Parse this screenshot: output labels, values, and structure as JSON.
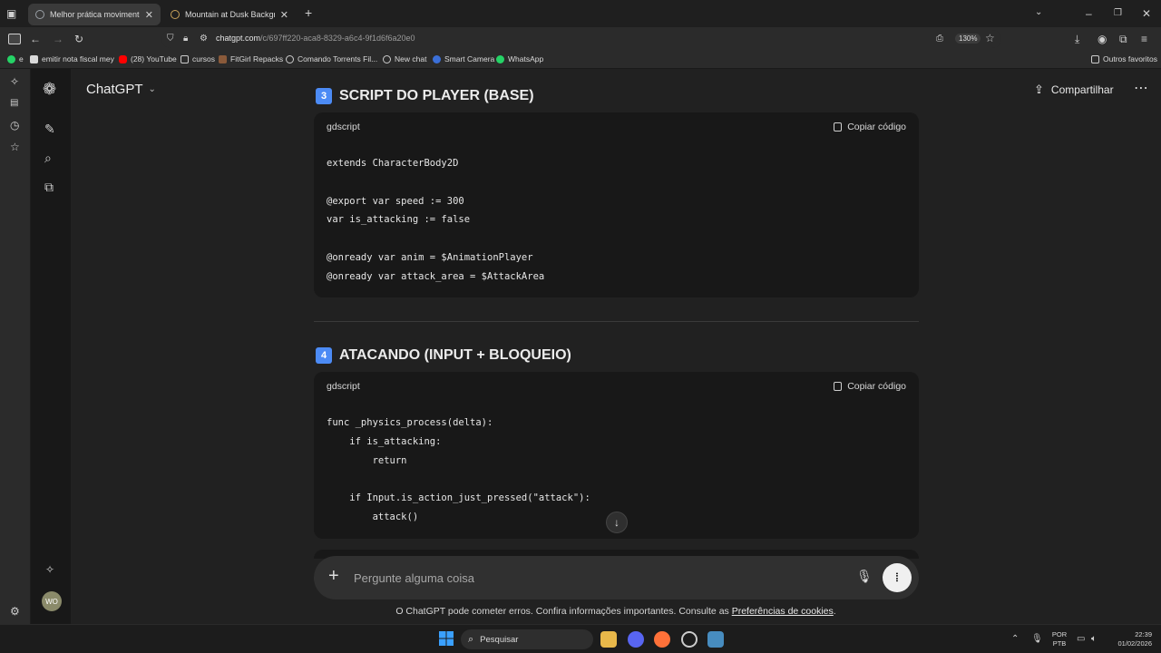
{
  "browser": {
    "tabs": [
      {
        "title": "Melhor prática movimento Godot",
        "active": true
      },
      {
        "title": "Mountain at Dusk Background",
        "active": false
      }
    ],
    "url": {
      "host": "chatgpt.com",
      "path": "/c/697ff220-aca8-8329-a6c4-9f1d6f6a20e0"
    },
    "zoom": "130%",
    "bookmarks": [
      "e",
      "emitir nota fiscal mey",
      "(28) YouTube",
      "cursos",
      "FitGirl Repacks",
      "Comando Torrents Fil...",
      "New chat",
      "Smart Camera",
      "WhatsApp"
    ],
    "other_bookmarks": "Outros favoritos"
  },
  "app": {
    "name": "ChatGPT",
    "share_label": "Compartilhar",
    "avatar_initials": "WO"
  },
  "sections": [
    {
      "number": "3",
      "title": "SCRIPT DO PLAYER (BASE)",
      "lang": "gdscript",
      "copy_label": "Copiar código",
      "code": "extends CharacterBody2D\n\n@export var speed := 300\nvar is_attacking := false\n\n@onready var anim = $AnimationPlayer\n@onready var attack_area = $AttackArea"
    },
    {
      "number": "4",
      "title": "ATACANDO (INPUT + BLOQUEIO)",
      "lang": "gdscript",
      "copy_label": "Copiar código",
      "code": "func _physics_process(delta):\n    if is_attacking:\n        return\n\n    if Input.is_action_just_pressed(\"attack\"):\n        attack()"
    }
  ],
  "composer": {
    "placeholder": "Pergunte alguma coisa"
  },
  "disclaimer": {
    "text": "O ChatGPT pode cometer erros. Confira informações importantes. Consulte as ",
    "link": "Preferências de cookies",
    "end": "."
  },
  "taskbar": {
    "search_label": "Pesquisar",
    "lang_top": "POR",
    "lang_bottom": "PTB",
    "time": "22:39",
    "date": "01/02/2026"
  },
  "colors": {
    "background": "#212121",
    "code_bg": "#181818",
    "accent_badge": "#4c8bf5"
  }
}
